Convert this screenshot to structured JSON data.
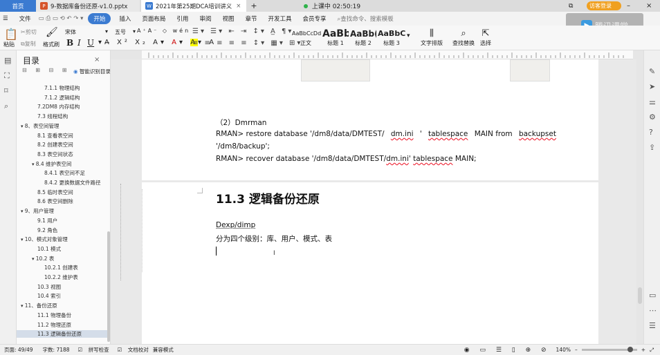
{
  "tabs": {
    "home": "首页",
    "doc1": "9-数据库备份还原-v1.0.pptx",
    "doc2": "2021年第25期DCA培训讲义"
  },
  "live_status": "上课中 02:50:19",
  "header_right": {
    "visitor": "访客登录",
    "overlay": "腾讯课堂"
  },
  "menu": {
    "file": "文件",
    "start": "开始",
    "insert": "插入",
    "layout": "页面布局",
    "ref": "引用",
    "review": "审阅",
    "view": "视图",
    "chapter": "章节",
    "dev": "开发工具",
    "member": "会员专享",
    "search": "查找命令、搜索模板"
  },
  "ribbon": {
    "paste": "粘贴",
    "cut": "剪切",
    "copy": "复制",
    "format": "格式刷",
    "font": "宋体",
    "size": "五号",
    "bold": "B",
    "italic": "I",
    "underline": "U",
    "style_normal_sample": "AaBbCcDd",
    "style_normal": "正文",
    "style_h1_sample": "AaBb",
    "style_h1": "标题 1",
    "style_h2_sample": "AaBb(",
    "style_h2": "标题 2",
    "style_h3_sample": "AaBbC(",
    "style_h3": "标题 3",
    "text_layout": "文字排版",
    "find_replace": "查找替换",
    "select": "选择"
  },
  "toc": {
    "title": "目录",
    "smart": "智能识别目录",
    "items": [
      {
        "text": "7.1.1 物理结构",
        "level": 4
      },
      {
        "text": "7.1.2 逻辑结构",
        "level": 4
      },
      {
        "text": "7.2DM8 内存结构",
        "level": 3
      },
      {
        "text": "7.3 线程结构",
        "level": 3
      },
      {
        "text": "8、表空间管理",
        "level": 2
      },
      {
        "text": "8.1 查看表空间",
        "level": 3
      },
      {
        "text": "8.2 创建表空间",
        "level": 3
      },
      {
        "text": "8.3 表空间状态",
        "level": 3
      },
      {
        "text": "8.4 维护表空间",
        "level": 3
      },
      {
        "text": "8.4.1 表空间不足",
        "level": 4
      },
      {
        "text": "8.4.2 更换数据文件路径",
        "level": 4
      },
      {
        "text": "8.5 临时表空间",
        "level": 3
      },
      {
        "text": "8.6 表空间删除",
        "level": 3
      },
      {
        "text": "9、用户管理",
        "level": 2
      },
      {
        "text": "9.1 用户",
        "level": 3
      },
      {
        "text": "9.2 角色",
        "level": 3
      },
      {
        "text": "10、模式对象管理",
        "level": 2
      },
      {
        "text": "10.1 模式",
        "level": 3
      },
      {
        "text": "10.2 表",
        "level": 3
      },
      {
        "text": "10.2.1 创建表",
        "level": 4
      },
      {
        "text": "10.2.2 维护表",
        "level": 4
      },
      {
        "text": "10.3 视图",
        "level": 3
      },
      {
        "text": "10.4 索引",
        "level": 3
      },
      {
        "text": "11、备份还原",
        "level": 2
      },
      {
        "text": "11.1 物理备份",
        "level": 3
      },
      {
        "text": "11.2 物理还原",
        "level": 3
      },
      {
        "text": "11.3 逻辑备份还原",
        "level": 3,
        "selected": true
      }
    ]
  },
  "doc": {
    "p1": "（2）Dmrman",
    "p2a": "RMAN>  restore  database  '/dm8/data/DMTEST/",
    "p2b": "dm.ini",
    "p2c": "'  ",
    "p2d": "tablespace",
    "p2e": "  MAIN  from  ",
    "p2f": "backupset",
    "p3": "'/dm8/backup';",
    "p4a": "RMAN> recover database '/dm8/data/DMTEST/",
    "p4b": "dm.ini",
    "p4c": "' ",
    "p4d": "tablespace",
    "p4e": " MAIN;",
    "heading": "11.3 逻辑备份还原",
    "p5": "Dexp/dimp",
    "p6": "分为四个级别：库、用户、模式、表"
  },
  "status": {
    "page": "页面: 49/49",
    "words": "字数: 7188",
    "spell": "拼写检查",
    "proof": "文档校对",
    "compat": "兼容模式",
    "zoom": "140%"
  }
}
